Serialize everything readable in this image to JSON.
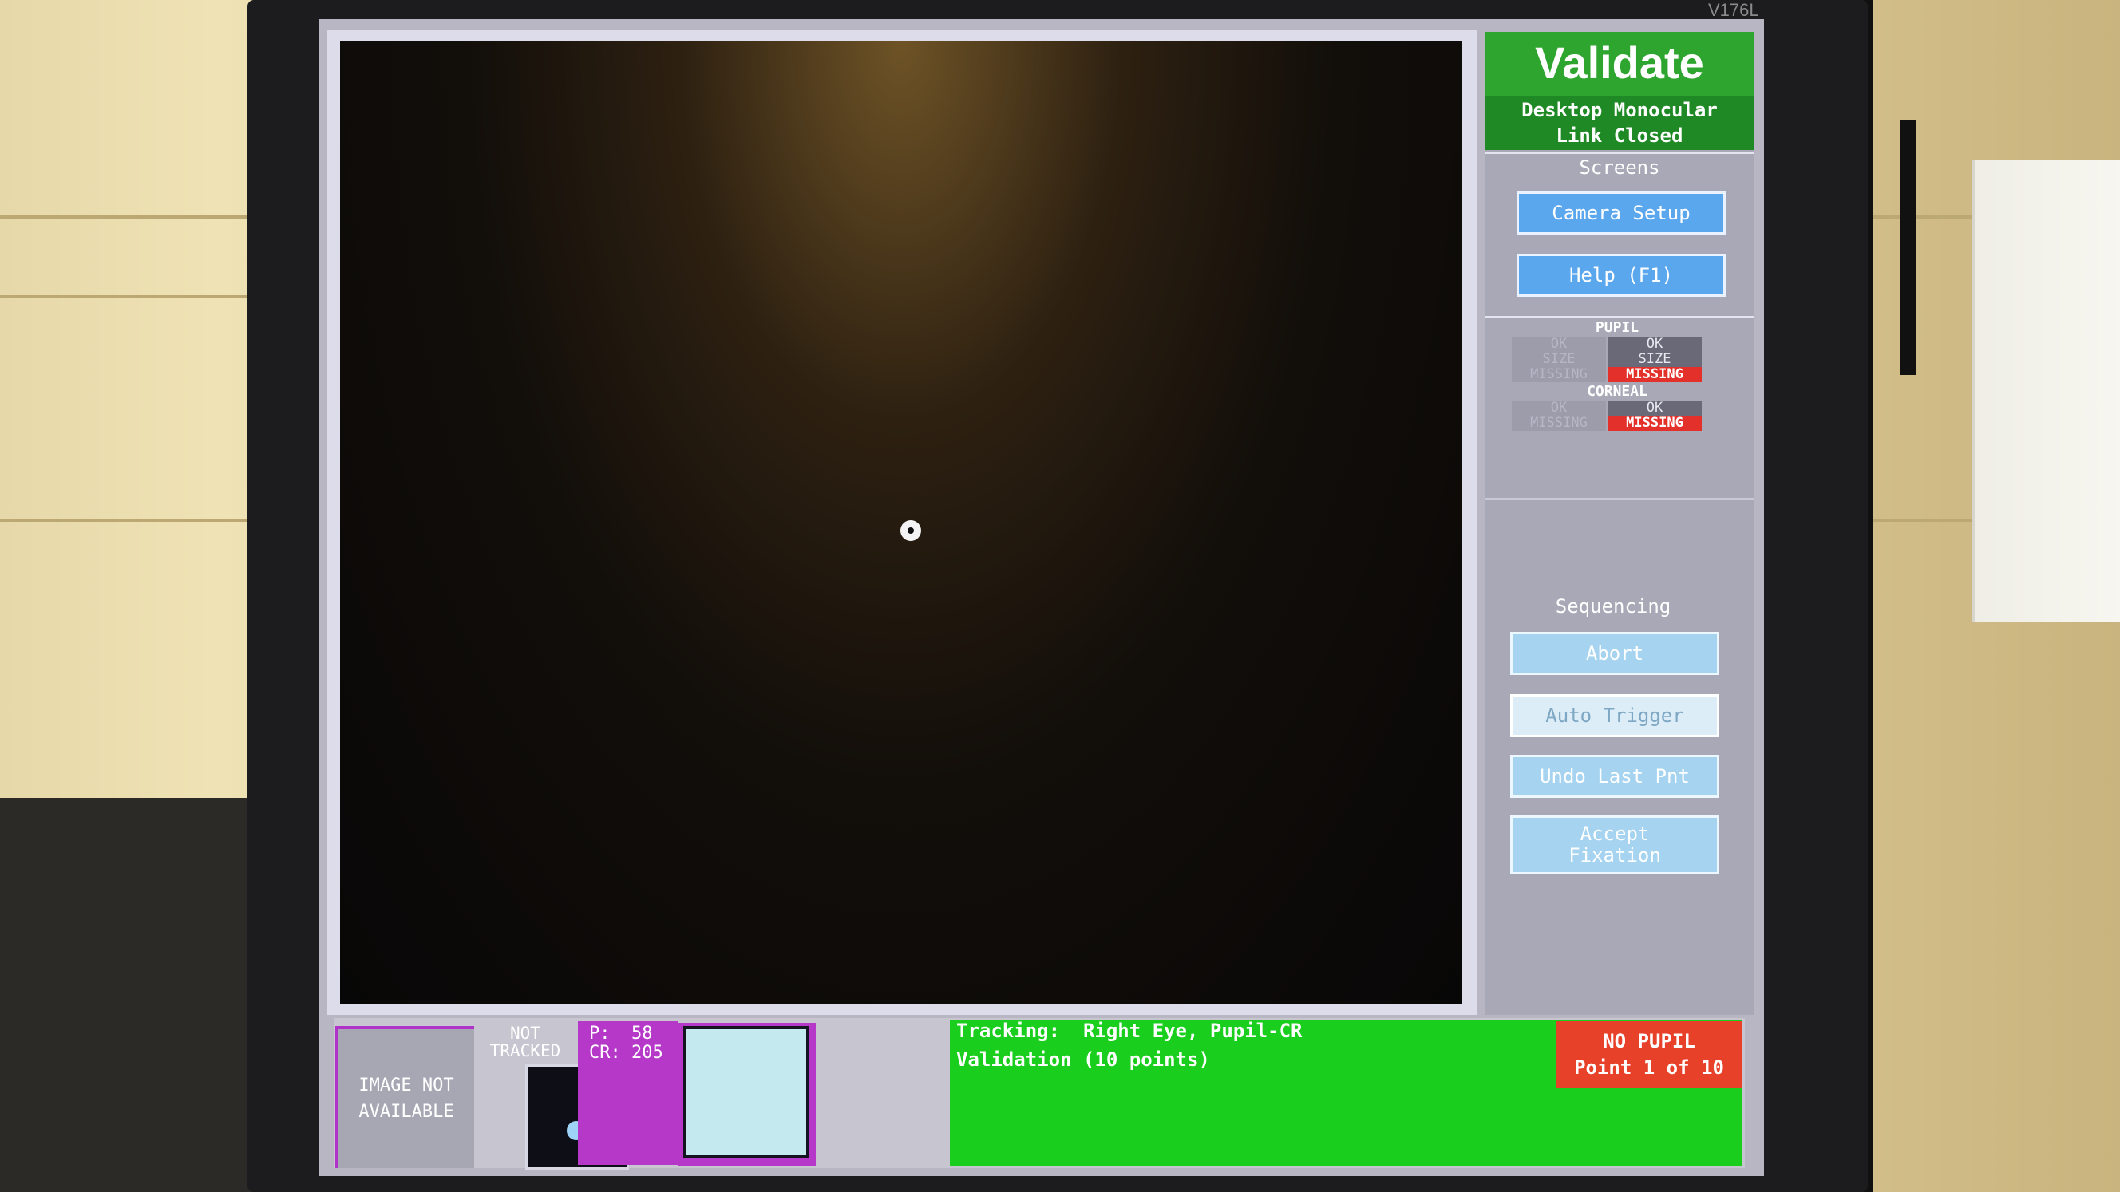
{
  "monitor": {
    "model": "V176L"
  },
  "panel": {
    "title": "Validate",
    "mode_line1": "Desktop Monocular",
    "mode_line2": "Link Closed",
    "screens_label": "Screens",
    "camera_setup": "Camera Setup",
    "help": "Help (F1)",
    "pupil_label": "PUPIL",
    "pupil_left": {
      "ok": "OK",
      "size": "SIZE",
      "missing": "MISSING"
    },
    "pupil_right": {
      "ok": "OK",
      "size": "SIZE",
      "missing": "MISSING"
    },
    "corneal_label": "CORNEAL",
    "corneal_left": {
      "ok": "OK",
      "missing": "MISSING"
    },
    "corneal_right": {
      "ok": "OK",
      "missing": "MISSING"
    },
    "sequencing_label": "Sequencing",
    "abort": "Abort",
    "auto_trigger": "Auto Trigger",
    "undo_last": "Undo Last Pnt",
    "accept_fixation": "Accept\nFixation"
  },
  "bottom": {
    "image_not_available": "IMAGE NOT\nAVAILABLE",
    "not_tracked": "NOT\nTRACKED",
    "pupil_value": "P:  58",
    "cr_value": "CR: 205",
    "tracking_line": "Tracking:  Right Eye, Pupil-CR",
    "validation_line": "Validation (10 points)",
    "alert_line1": "NO PUPIL",
    "alert_line2": "Point 1 of 10"
  },
  "colors": {
    "title_green": "#2ea52f",
    "status_green": "#19ce1c",
    "alert_red": "#e8412a",
    "button_blue": "#5aa7ee",
    "magenta": "#b638c8"
  }
}
